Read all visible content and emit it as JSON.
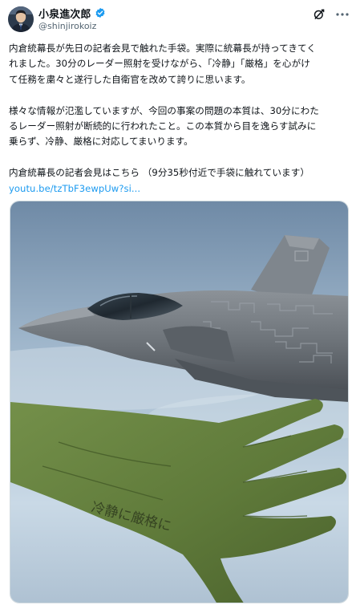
{
  "author": {
    "display_name": "小泉進次郎",
    "handle": "@shinjirokoiz",
    "verified_color": "#1d9bf0"
  },
  "icons": {
    "avatar": "avatar-icon",
    "verified": "verified-badge-icon",
    "grok": "grok-icon",
    "more": "more-icon"
  },
  "post": {
    "lines": [
      "内倉統幕長が先日の記者会見で触れた手袋。実際に統幕長が持ってきてく",
      "れました。30分のレーダー照射を受けながら、「冷静」「厳格」を心がけ",
      "て任務を粛々と遂行した自衛官を改めて誇りに思います。",
      "",
      "様々な情報が氾濫していますが、今回の事案の問題の本質は、30分にわた",
      "るレーダー照射が断続的に行われたこと。この本質から目を逸らす試みに",
      "乗らず、冷静、厳格に対応してまいります。",
      "",
      "内倉統幕長の記者会見はこちら （9分35秒付近で手袋に触れています）"
    ],
    "link_text": "youtu.be/tzTbF3ewpUw?si..."
  },
  "media": {
    "glove_inscription": "冷静に厳格に"
  },
  "colors": {
    "link": "#1d9bf0",
    "secondary_text": "#536471",
    "glove": "#5f7a3a",
    "sky": "#b9cfe2",
    "jet": "#6f757b"
  }
}
